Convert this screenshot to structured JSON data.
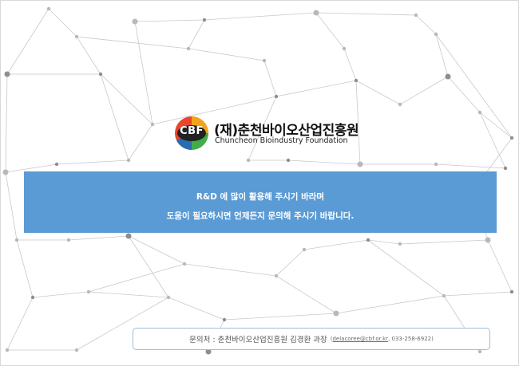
{
  "logo": {
    "mark_text": "CBF",
    "name_ko": "(재)춘천바이오산업진흥원",
    "name_en": "Chuncheon Bioindustry Foundation"
  },
  "banner": {
    "line1": "R&D 에 많이 활용해 주시기 바라며",
    "line2": "도움이 필요하시면 언제든지 문의해 주시기 바랍니다."
  },
  "contact": {
    "text": "문의처 : 춘천바이오산업진흥원 김경환 과장",
    "open_paren": "(",
    "email": "delacoree@cbf.or.kr",
    "phone": ", 033-258-6922)"
  },
  "colors": {
    "banner_bg": "#5b9bd5",
    "logo_ring_red": "#e8452c",
    "logo_ring_orange": "#f5a21b",
    "logo_ring_green": "#3fae49",
    "logo_ring_blue": "#2b6cb0"
  }
}
